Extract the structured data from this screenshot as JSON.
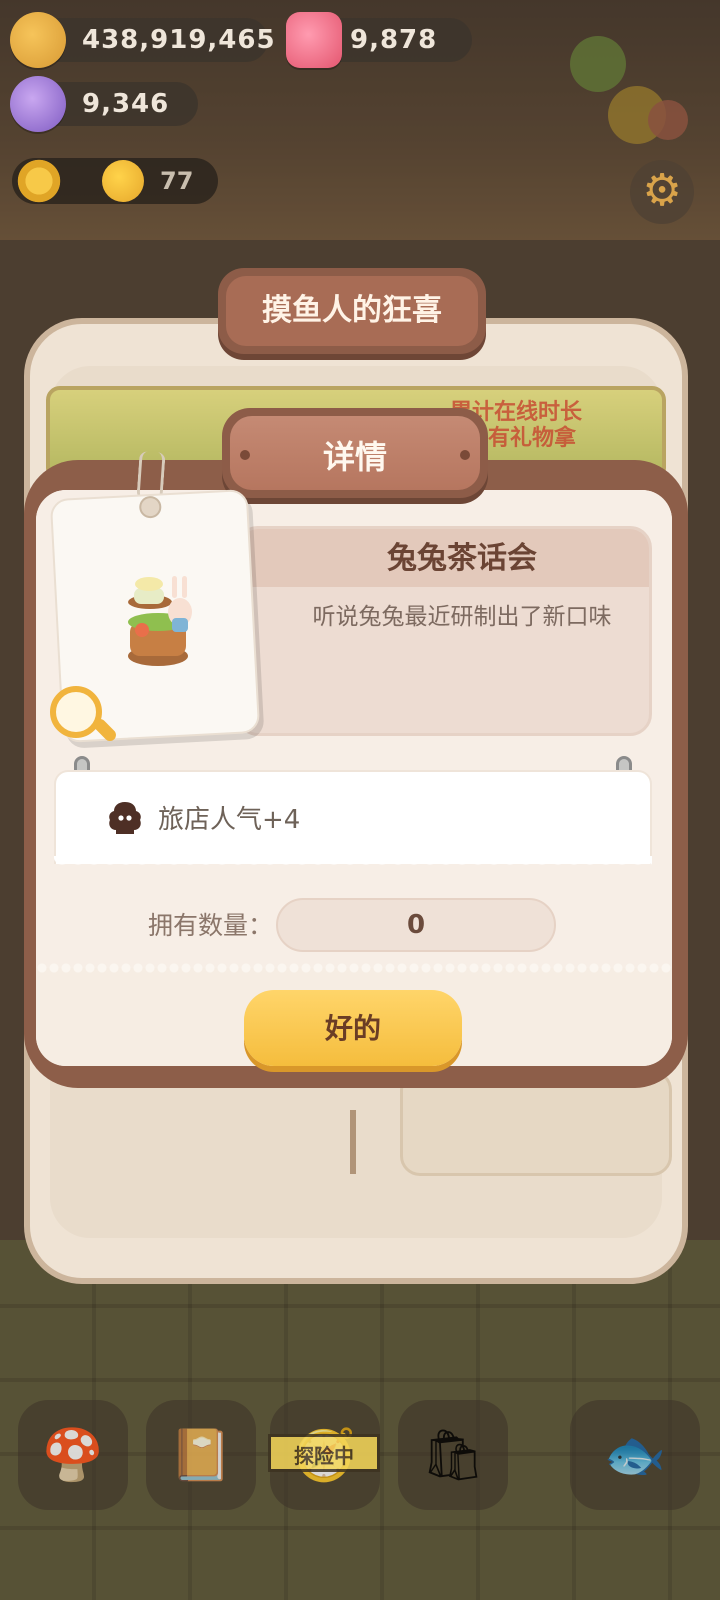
{
  "currencies": {
    "coins": "438,919,465",
    "gems": "9,878",
    "candy": "9,346",
    "level": "77"
  },
  "event": {
    "title": "摸鱼人的狂喜",
    "banner_text_line1": "累计在线时长",
    "banner_text_line2": "就有礼物拿"
  },
  "dialog": {
    "title": "详情",
    "item_name": "兔兔茶话会",
    "item_description": "听说兔兔最近研制出了新口味",
    "effect": "旅店人气+4",
    "quantity_label": "拥有数量：",
    "quantity_value": "0",
    "ok_label": "好的"
  },
  "nav": {
    "explore_label": "探险中"
  },
  "colors": {
    "dialog_frame": "#8d5e49",
    "button_yellow": "#f5bd3d",
    "title_text": "#6b4434"
  }
}
